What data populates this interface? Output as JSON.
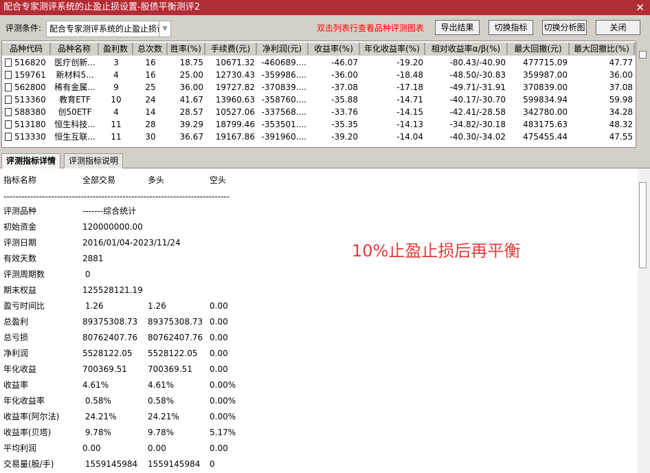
{
  "window": {
    "title": "配合专家测评系统的止盈止损设置-股债平衡测评2",
    "close_icon": "close-icon"
  },
  "toolbar": {
    "condition_label": "评测条件:",
    "condition_value": "配合专家测评系统的止盈止损设置",
    "hint": "双击列表行查看品种评测图表",
    "export": "导出结果",
    "switch_indicator": "切换指标",
    "switch_chart": "切换分析图",
    "close": "关闭"
  },
  "table": {
    "columns": [
      "品种代码",
      "品种名称",
      "盈利数",
      "总次数",
      "胜率(%)",
      "手续费(元)",
      "净利润(元)",
      "收益率(%)",
      "年化收益率(%)",
      "相对收益率α/β(%)",
      "最大回撤(元)",
      "最大回撤比(%)"
    ],
    "rows": [
      [
        "516820",
        "医疗创新...",
        "3",
        "16",
        "18.75",
        "10671.32",
        "-460689....",
        "-46.07",
        "-19.20",
        "-80.43/-40.90",
        "477715.09",
        "47.77"
      ],
      [
        "159761",
        "新材料5...",
        "4",
        "16",
        "25.00",
        "12730.43",
        "-359986....",
        "-36.00",
        "-18.48",
        "-48.50/-30.83",
        "359987.00",
        "36.00"
      ],
      [
        "562800",
        "稀有金属...",
        "9",
        "25",
        "36.00",
        "19727.82",
        "-370839....",
        "-37.08",
        "-17.18",
        "-49.71/-31.91",
        "370839.00",
        "37.08"
      ],
      [
        "513360",
        "教育ETF",
        "10",
        "24",
        "41.67",
        "13960.63",
        "-358760....",
        "-35.88",
        "-14.71",
        "-40.17/-30.70",
        "599834.94",
        "59.98"
      ],
      [
        "588380",
        "创50ETF",
        "4",
        "14",
        "28.57",
        "10527.06",
        "-337568....",
        "-33.76",
        "-14.15",
        "-42.41/-28.58",
        "342780.00",
        "34.28"
      ],
      [
        "513180",
        "恒生科技...",
        "11",
        "28",
        "39.29",
        "18799.46",
        "-353501....",
        "-35.35",
        "-14.13",
        "-34.82/-30.18",
        "483175.63",
        "48.32"
      ],
      [
        "513330",
        "恒生互联...",
        "11",
        "30",
        "36.67",
        "19167.86",
        "-391960....",
        "-39.20",
        "-14.04",
        "-40.30/-34.02",
        "475455.44",
        "47.55"
      ]
    ]
  },
  "tabs": [
    {
      "label": "评测指标详情",
      "active": true
    },
    {
      "label": "评测指标说明",
      "active": false
    }
  ],
  "details": {
    "header": [
      "指标名称",
      "全部交易",
      "多头",
      "空头"
    ],
    "separator": "----------------------------------------------------------------------------",
    "rows": [
      [
        "评测品种",
        "-------综合统计",
        "",
        ""
      ],
      [
        "初始资金",
        "120000000.00",
        "",
        ""
      ],
      [
        "评测日期",
        "2016/01/04-2023/11/24",
        "",
        ""
      ],
      [
        "有效天数",
        "2881",
        "",
        ""
      ],
      [
        "评测周期数",
        " 0",
        "",
        ""
      ],
      [
        "期末权益",
        "125528121.19",
        "",
        ""
      ],
      [
        "盈亏时间比",
        " 1.26",
        "1.26",
        "0.00"
      ],
      [
        "总盈利",
        "89375308.73",
        "89375308.73",
        "0.00"
      ],
      [
        "总亏损",
        "80762407.76",
        "80762407.76",
        "0.00"
      ],
      [
        "净利润",
        "5528122.05",
        "5528122.05",
        "0.00"
      ],
      [
        "年化收益",
        "700369.51",
        "700369.51",
        "0.00"
      ],
      [
        "收益率",
        "4.61%",
        "4.61%",
        "0.00%"
      ],
      [
        "年化收益率",
        " 0.58%",
        "0.58%",
        "0.00%"
      ],
      [
        "收益率(阿尔法)",
        " 24.21%",
        "24.21%",
        "0.00%"
      ],
      [
        "收益率(贝塔)",
        " 9.78%",
        "9.78%",
        "5.17%"
      ],
      [
        "平均利润",
        "0.00",
        "0.00",
        "0.00"
      ],
      [
        "交易量(股/手)",
        " 1559145984",
        "1559145984",
        "0"
      ]
    ]
  },
  "annotation": "10%止盈止损后再平衡",
  "colors": {
    "titlebar": "#b22d33",
    "hint": "#ff0000",
    "annotation": "#e53935"
  }
}
